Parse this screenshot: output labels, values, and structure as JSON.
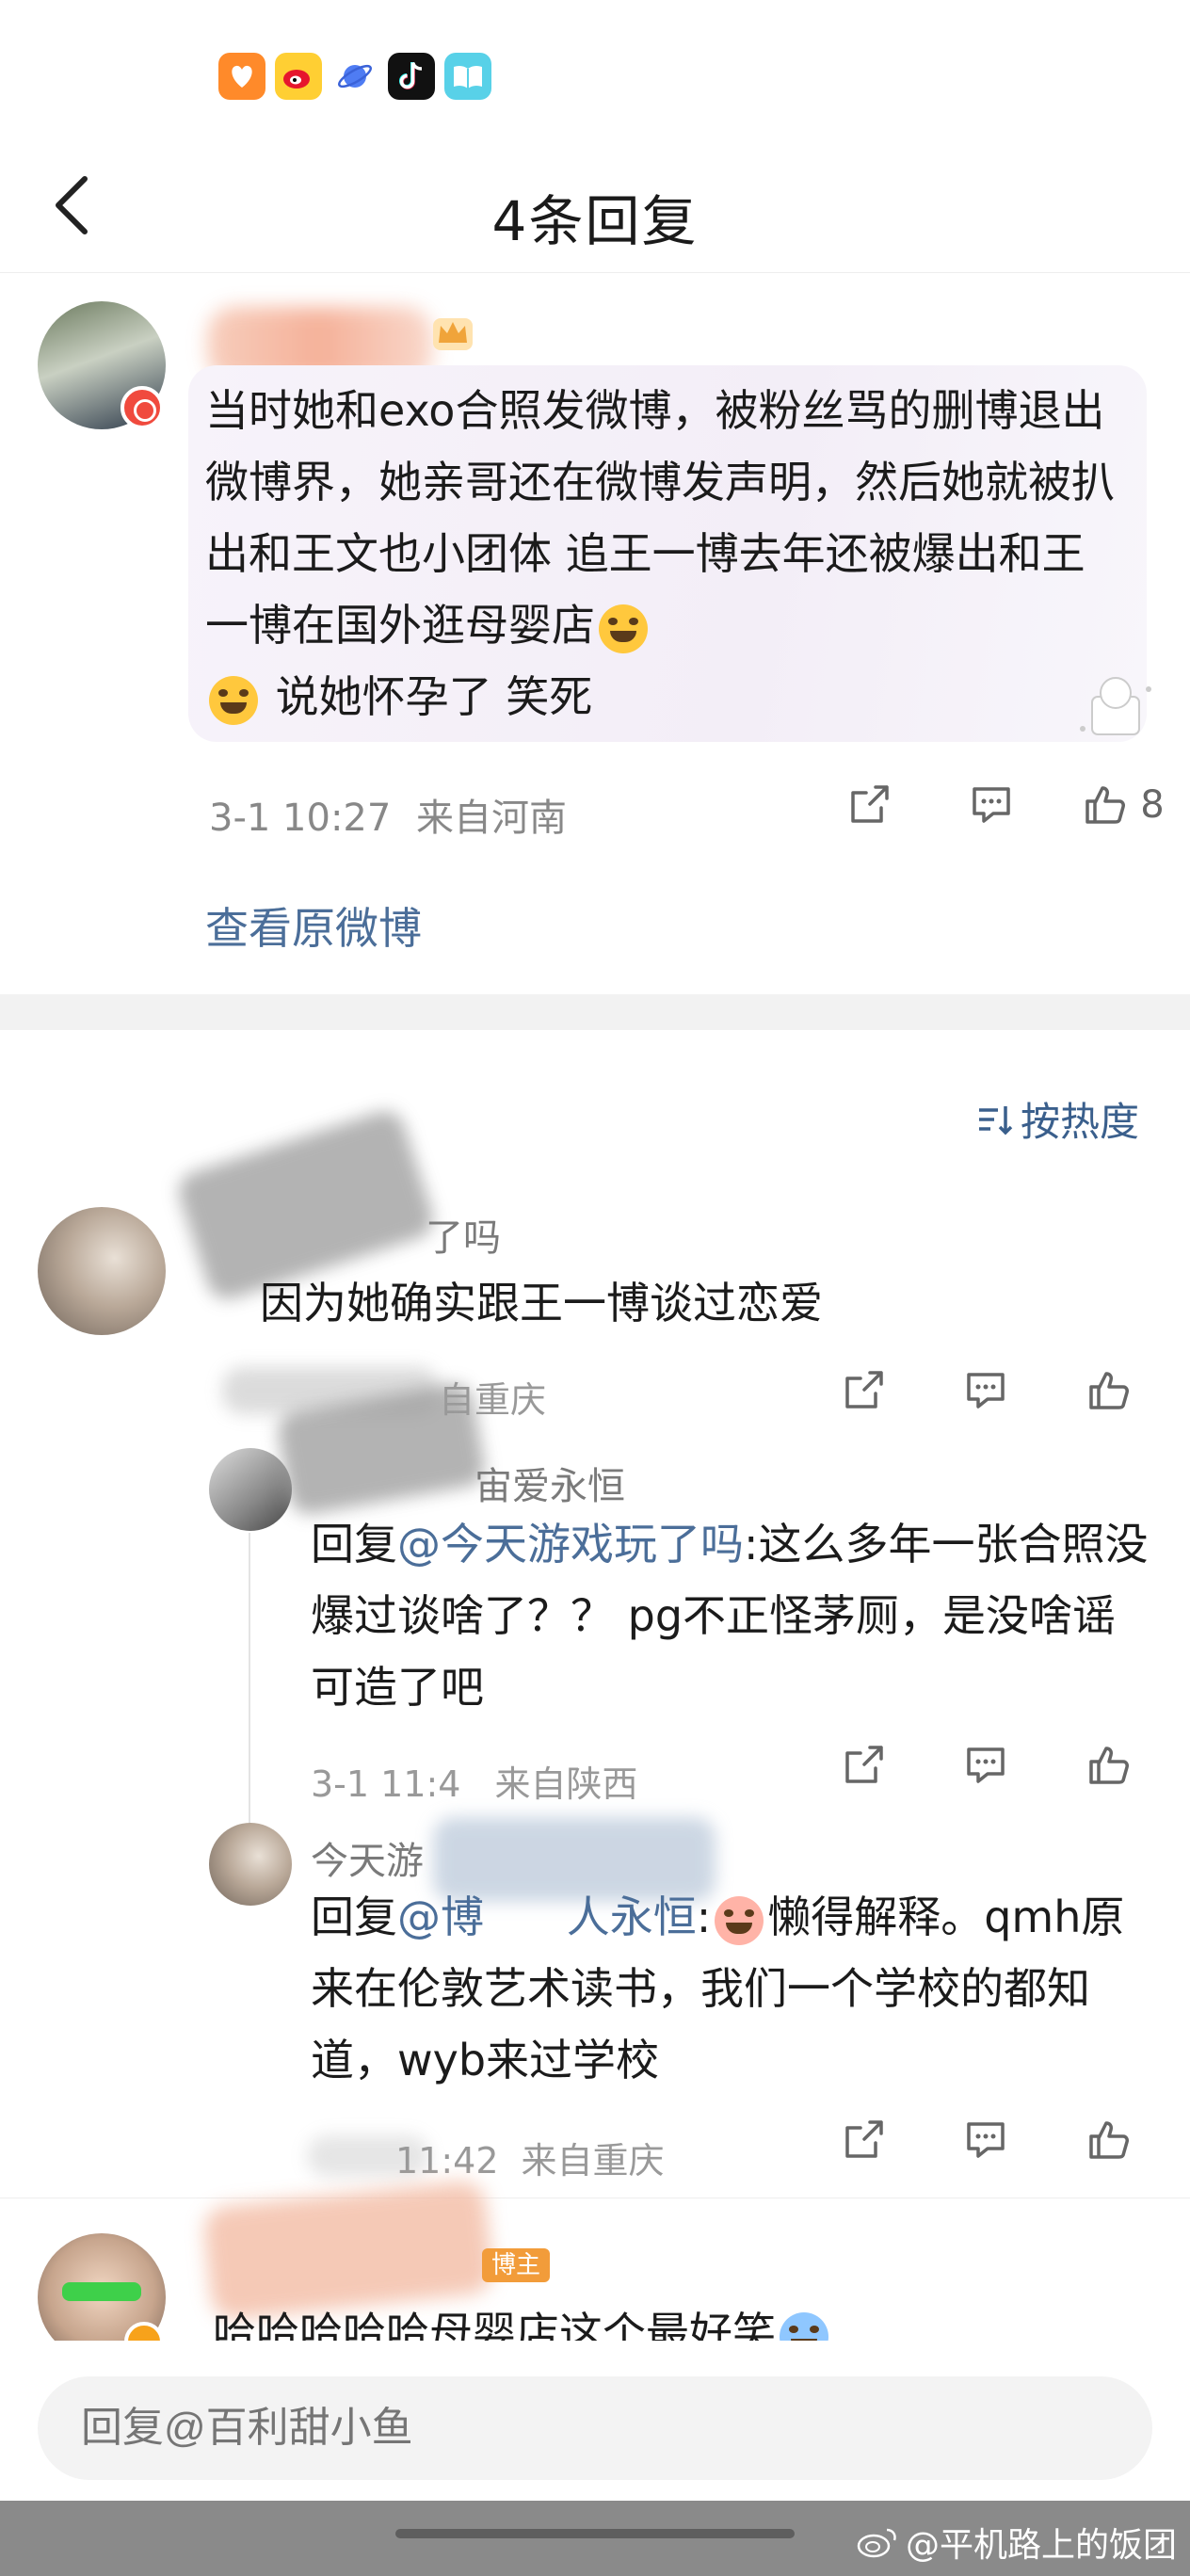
{
  "nav": {
    "title": "4条回复"
  },
  "main_comment": {
    "text": "当时她和exo合照发微博，被粉丝骂的删博退出微博界，她亲哥还在微博发声明，然后她就被扒出和王文也小团体 追王一博去年还被爆出和王一博在国外逛母婴店",
    "text_tail": " 说她怀孕了 笑死",
    "time": "3-1 10:27",
    "location": "来自河南",
    "like_count": "8",
    "view_original": "查看原微博"
  },
  "sort": {
    "label": "按热度"
  },
  "comments": [
    {
      "name_visible": "了吗",
      "text": "因为她确实跟王一博谈过恋爱",
      "meta_visible": "自重庆"
    },
    {
      "name_visible": "宙爱永恒",
      "reply_prefix": "回复",
      "mention": "@今天游戏玩了吗",
      "text": ":这么多年一张合照没爆过谈啥了？？ pg不正怪茅厕，是没啥谣可造了吧",
      "meta_time": "3-1 11:4",
      "meta_loc": "来自陕西"
    },
    {
      "name_visible": "今天游",
      "reply_prefix": "回复",
      "mention": "@博",
      "mention_tail": "人永恒",
      "text": "懒得解释。qmh原来在伦敦艺术读书，我们一个学校的都知道，wyb来过学校",
      "meta_time": "11:42",
      "meta_loc": "来自重庆"
    },
    {
      "badge": "博主",
      "text": "哈哈哈哈哈母婴店这个最好笑"
    }
  ],
  "reply_box": {
    "placeholder": "回复@百利甜小鱼"
  },
  "watermark": {
    "text": "@平机路上的饭团"
  }
}
